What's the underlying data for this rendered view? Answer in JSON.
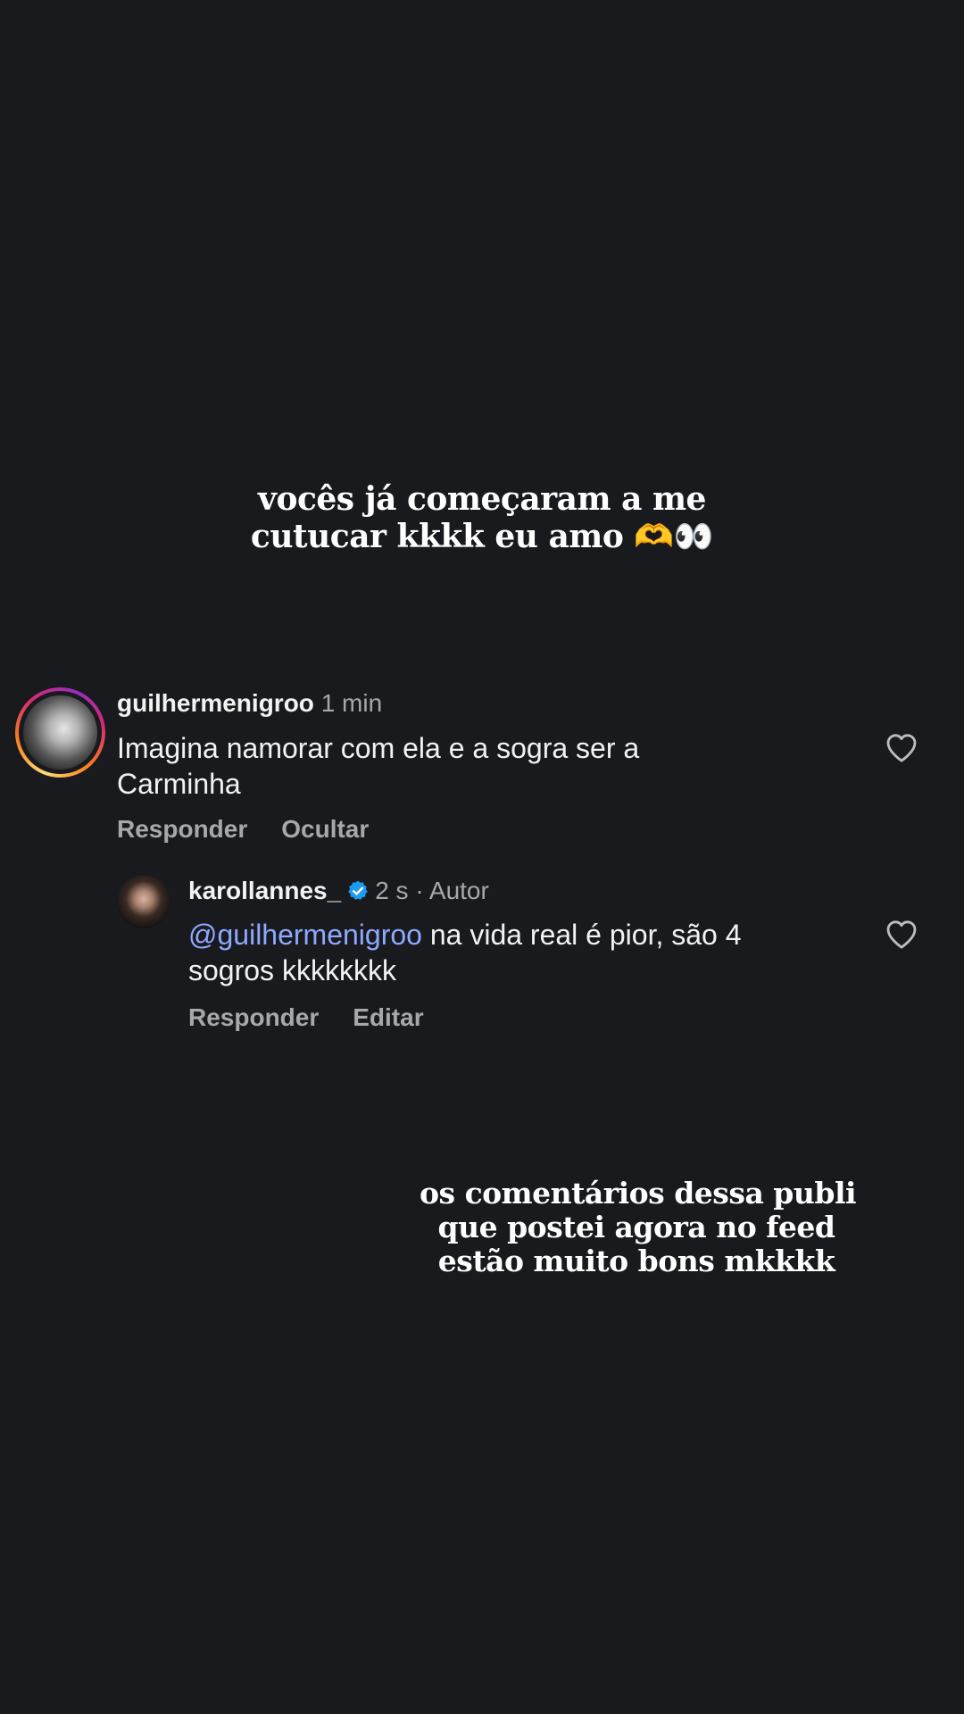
{
  "overlay_top": {
    "line1": "vocês já começaram a me",
    "line2": "cutucar kkkk eu amo 🫶👀"
  },
  "comment1": {
    "username": "guilhermenigroo",
    "time": "1 min",
    "text_line1": "Imagina namorar com ela e a sogra ser a",
    "text_line2": "Carminha",
    "reply_label": "Responder",
    "hide_label": "Ocultar"
  },
  "comment2": {
    "username": "karollannes_",
    "time": "2 s",
    "separator": "·",
    "author_label": "Autor",
    "mention": "@guilhermenigroo",
    "text_line1": " na vida real é pior, são 4",
    "text_line2": "sogros kkkkkkkk",
    "reply_label": "Responder",
    "edit_label": "Editar"
  },
  "overlay_bottom": {
    "line1": "os comentários dessa publi",
    "line2": "que postei agora no feed",
    "line3": "estão muito bons mkkkk"
  },
  "icons": {
    "like": "heart-outline-icon",
    "verified": "verified-badge-icon"
  },
  "colors": {
    "background": "#181a1e",
    "mention": "#8fa8ff",
    "verified": "#1d9bf0",
    "muted": "#a8a8a8"
  }
}
